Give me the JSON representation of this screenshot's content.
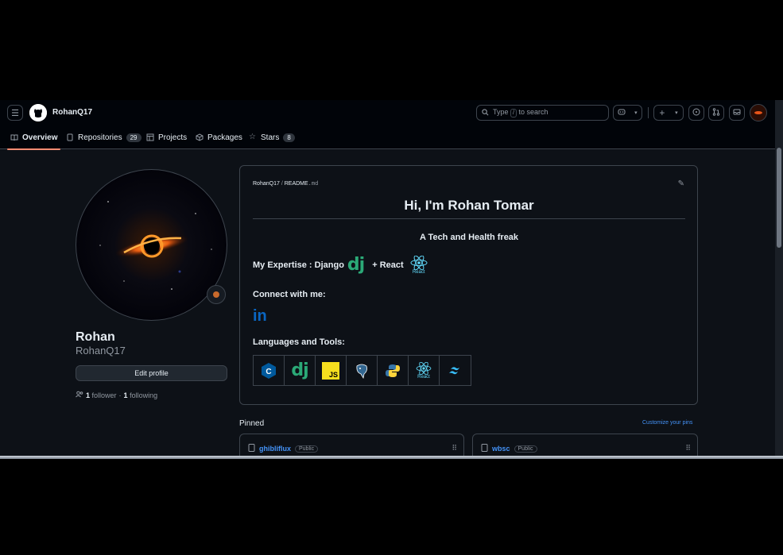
{
  "header": {
    "username": "RohanQ17",
    "search_prefix": "Type",
    "search_key": "/",
    "search_suffix": "to search"
  },
  "tabs": [
    {
      "label": "Overview",
      "icon": "book-icon"
    },
    {
      "label": "Repositories",
      "icon": "repo-icon",
      "count": "29"
    },
    {
      "label": "Projects",
      "icon": "table-icon"
    },
    {
      "label": "Packages",
      "icon": "package-icon"
    },
    {
      "label": "Stars",
      "icon": "star-icon",
      "count": "8"
    }
  ],
  "profile": {
    "full_name": "Rohan",
    "login": "RohanQ17",
    "edit_label": "Edit profile",
    "followers": "1",
    "followers_label": "follower",
    "following": "1",
    "following_label": "following"
  },
  "readme": {
    "owner": "RohanQ17",
    "sep": "/",
    "file": "README",
    "ext": ".md",
    "heading": "Hi, I'm Rohan Tomar",
    "tagline": "A Tech and Health freak",
    "expertise_label": "My Expertise : Django",
    "plus_react": "+ React",
    "react_caption": "React",
    "connect_label": "Connect with me:",
    "linkedin_text": "in",
    "languages_label": "Languages and Tools:",
    "tools": [
      {
        "name": "cplusplus",
        "label": "C"
      },
      {
        "name": "django",
        "label": "dj"
      },
      {
        "name": "javascript",
        "label": "JS"
      },
      {
        "name": "postgresql",
        "label": ""
      },
      {
        "name": "python",
        "label": ""
      },
      {
        "name": "react",
        "label": "React"
      },
      {
        "name": "tailwind",
        "label": ""
      }
    ]
  },
  "pinned": {
    "title": "Pinned",
    "customize": "Customize your pins",
    "repos": [
      {
        "name": "ghibliflux",
        "visibility": "Public"
      },
      {
        "name": "wbsc",
        "visibility": "Public"
      }
    ]
  },
  "colors": {
    "bg": "#0d1117",
    "header_bg": "#010409",
    "border": "#3d444d",
    "link": "#4493f8",
    "tab_underline": "#fd8c73",
    "django_green": "#2ba977",
    "react_cyan": "#61dafb"
  }
}
